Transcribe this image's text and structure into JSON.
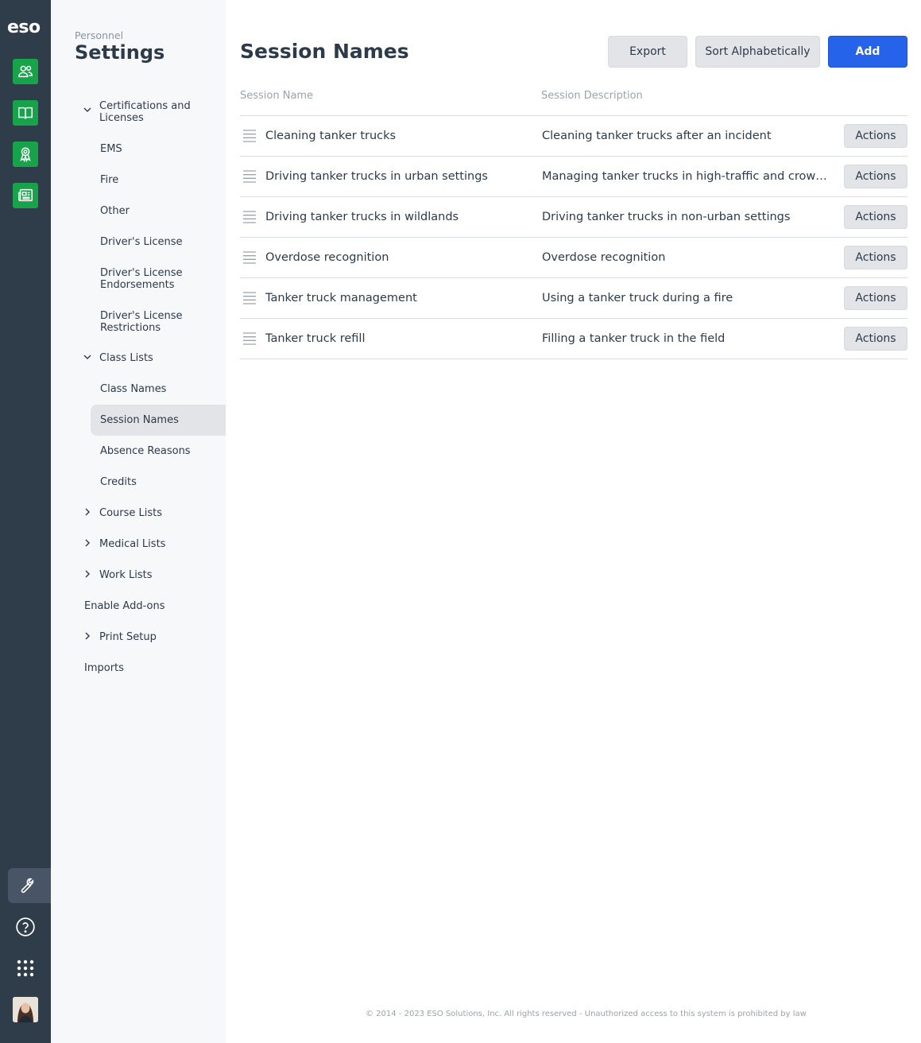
{
  "rail": {
    "logo": "eso",
    "apps": [
      {
        "icon": "people-icon"
      },
      {
        "icon": "book-icon"
      },
      {
        "icon": "award-ribbon-icon"
      },
      {
        "icon": "newspaper-icon"
      }
    ],
    "bottom": [
      {
        "icon": "wrench-icon",
        "active": true
      },
      {
        "icon": "help-circle-icon"
      },
      {
        "icon": "apps-grid-icon"
      },
      {
        "icon": "user-avatar"
      }
    ],
    "accent": "#16a34a",
    "background": "#2f3c4a"
  },
  "settings_nav": {
    "overline": "Personnel",
    "title": "Settings",
    "items": {
      "certifications": "Certifications and Licenses",
      "ems": "EMS",
      "fire": "Fire",
      "other": "Other",
      "drivers_license": "Driver's License",
      "drivers_license_endorsements": "Driver's License Endorsements",
      "drivers_license_restrictions": "Driver's License Restrictions",
      "class_lists": "Class Lists",
      "class_names": "Class Names",
      "session_names": "Session Names",
      "absence_reasons": "Absence Reasons",
      "credits": "Credits",
      "course_lists": "Course Lists",
      "medical_lists": "Medical Lists",
      "work_lists": "Work Lists",
      "enable_addons": "Enable Add-ons",
      "print_setup": "Print Setup",
      "imports": "Imports"
    }
  },
  "main": {
    "title": "Session Names",
    "buttons": {
      "export": "Export",
      "sort": "Sort Alphabetically",
      "add": "Add"
    },
    "columns": {
      "name": "Session Name",
      "description": "Session Description"
    },
    "actions_label": "Actions",
    "rows": [
      {
        "name": "Cleaning tanker trucks",
        "description": "Cleaning tanker trucks after an incident"
      },
      {
        "name": "Driving tanker trucks in urban settings",
        "description": "Managing tanker trucks in high-traffic and crowded areas"
      },
      {
        "name": "Driving tanker trucks in wildlands",
        "description": "Driving tanker trucks in non-urban settings"
      },
      {
        "name": "Overdose recognition",
        "description": "Overdose recognition"
      },
      {
        "name": "Tanker truck management",
        "description": "Using a tanker truck during a fire"
      },
      {
        "name": "Tanker truck refill",
        "description": "Filling a tanker truck in the field"
      }
    ],
    "primary_color": "#2563eb"
  },
  "footer": "© 2014 - 2023 ESO Solutions, Inc. All rights reserved - Unauthorized access to this system is prohibited by law"
}
